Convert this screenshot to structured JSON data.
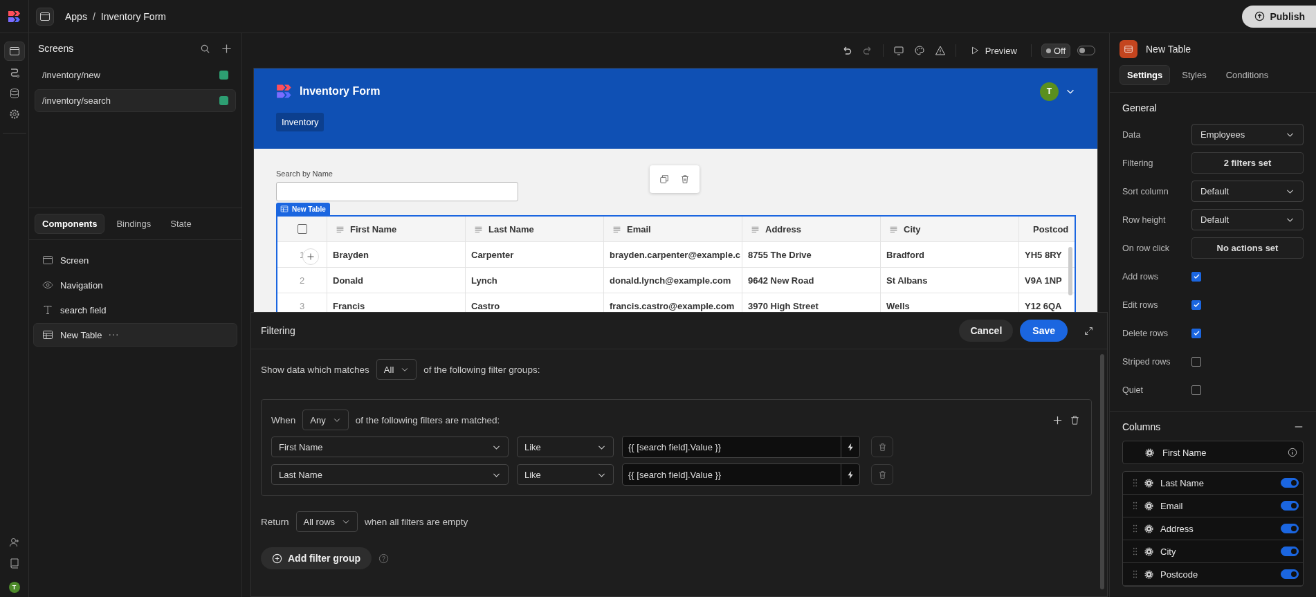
{
  "top_bar": {
    "breadcrumb": [
      "Apps",
      "Inventory Form"
    ],
    "separator": "/",
    "publish": "Publish"
  },
  "rail": {
    "avatar": "T"
  },
  "screens": {
    "title": "Screens",
    "items": [
      {
        "path": "/inventory/new",
        "selected": false
      },
      {
        "path": "/inventory/search",
        "selected": true
      }
    ]
  },
  "component_tabs": [
    {
      "label": "Components",
      "selected": true
    },
    {
      "label": "Bindings",
      "selected": false
    },
    {
      "label": "State",
      "selected": false
    }
  ],
  "components": [
    {
      "label": "Screen",
      "kind": "screen",
      "selected": false
    },
    {
      "label": "Navigation",
      "kind": "navigation",
      "selected": false
    },
    {
      "label": "search field",
      "kind": "text",
      "selected": false
    },
    {
      "label": "New Table",
      "kind": "table",
      "selected": true
    }
  ],
  "toolbar": {
    "preview": "Preview",
    "live": {
      "label": "Off",
      "on": false
    }
  },
  "app_preview": {
    "title": "Inventory Form",
    "avatar": "T",
    "nav_items": [
      {
        "label": "Inventory",
        "selected": true
      }
    ],
    "search_label": "Search by Name",
    "table_tag": "New Table",
    "table": {
      "select_all_checked": false,
      "columns": [
        "First Name",
        "Last Name",
        "Email",
        "Address",
        "City",
        "Postcod"
      ],
      "rows": [
        {
          "number": "1",
          "cells": [
            "Brayden",
            "Carpenter",
            "brayden.carpenter@example.c",
            "8755 The Drive",
            "Bradford",
            "YH5 8RY"
          ]
        },
        {
          "number": "2",
          "cells": [
            "Donald",
            "Lynch",
            "donald.lynch@example.com",
            "9642 New Road",
            "St Albans",
            "V9A 1NP"
          ]
        },
        {
          "number": "3",
          "cells": [
            "Francis",
            "Castro",
            "francis.castro@example.com",
            "3970 High Street",
            "Wells",
            "Y12 6QA"
          ]
        }
      ]
    }
  },
  "filtering": {
    "title": "Filtering",
    "cancel": "Cancel",
    "save": "Save",
    "match_prefix": "Show data which matches",
    "match_value": "All",
    "match_suffix": "of the following filter groups:",
    "groups": [
      {
        "when": "When",
        "match_value": "Any",
        "suffix": "of the following filters are matched:",
        "filters": [
          {
            "field": "First Name",
            "operator": "Like",
            "value": "{{ [search field].Value }}"
          },
          {
            "field": "Last Name",
            "operator": "Like",
            "value": "{{ [search field].Value }}"
          }
        ]
      }
    ],
    "return_label": "Return",
    "return_value": "All rows",
    "return_suffix": "when all filters are empty",
    "add_group": "Add filter group"
  },
  "settings_panel": {
    "title": "New Table",
    "tabs": [
      {
        "label": "Settings",
        "selected": true
      },
      {
        "label": "Styles",
        "selected": false
      },
      {
        "label": "Conditions",
        "selected": false
      }
    ],
    "section": "General",
    "fields": [
      {
        "label": "Data",
        "kind": "select",
        "value": "Employees"
      },
      {
        "label": "Filtering",
        "kind": "button",
        "value": "2 filters set"
      },
      {
        "label": "Sort column",
        "kind": "select",
        "value": "Default"
      },
      {
        "label": "Row height",
        "kind": "select",
        "value": "Default"
      },
      {
        "label": "On row click",
        "kind": "button",
        "value": "No actions set"
      },
      {
        "label": "Add rows",
        "kind": "checkbox",
        "checked": true
      },
      {
        "label": "Edit rows",
        "kind": "checkbox",
        "checked": true
      },
      {
        "label": "Delete rows",
        "kind": "checkbox",
        "checked": true
      },
      {
        "label": "Striped rows",
        "kind": "checkbox",
        "checked": false
      },
      {
        "label": "Quiet",
        "kind": "checkbox",
        "checked": false
      }
    ],
    "columns_title": "Columns",
    "primary_column": "First Name",
    "columns": [
      {
        "name": "Last Name",
        "on": true
      },
      {
        "name": "Email",
        "on": true
      },
      {
        "name": "Address",
        "on": true
      },
      {
        "name": "City",
        "on": true
      },
      {
        "name": "Postcode",
        "on": true
      }
    ]
  }
}
